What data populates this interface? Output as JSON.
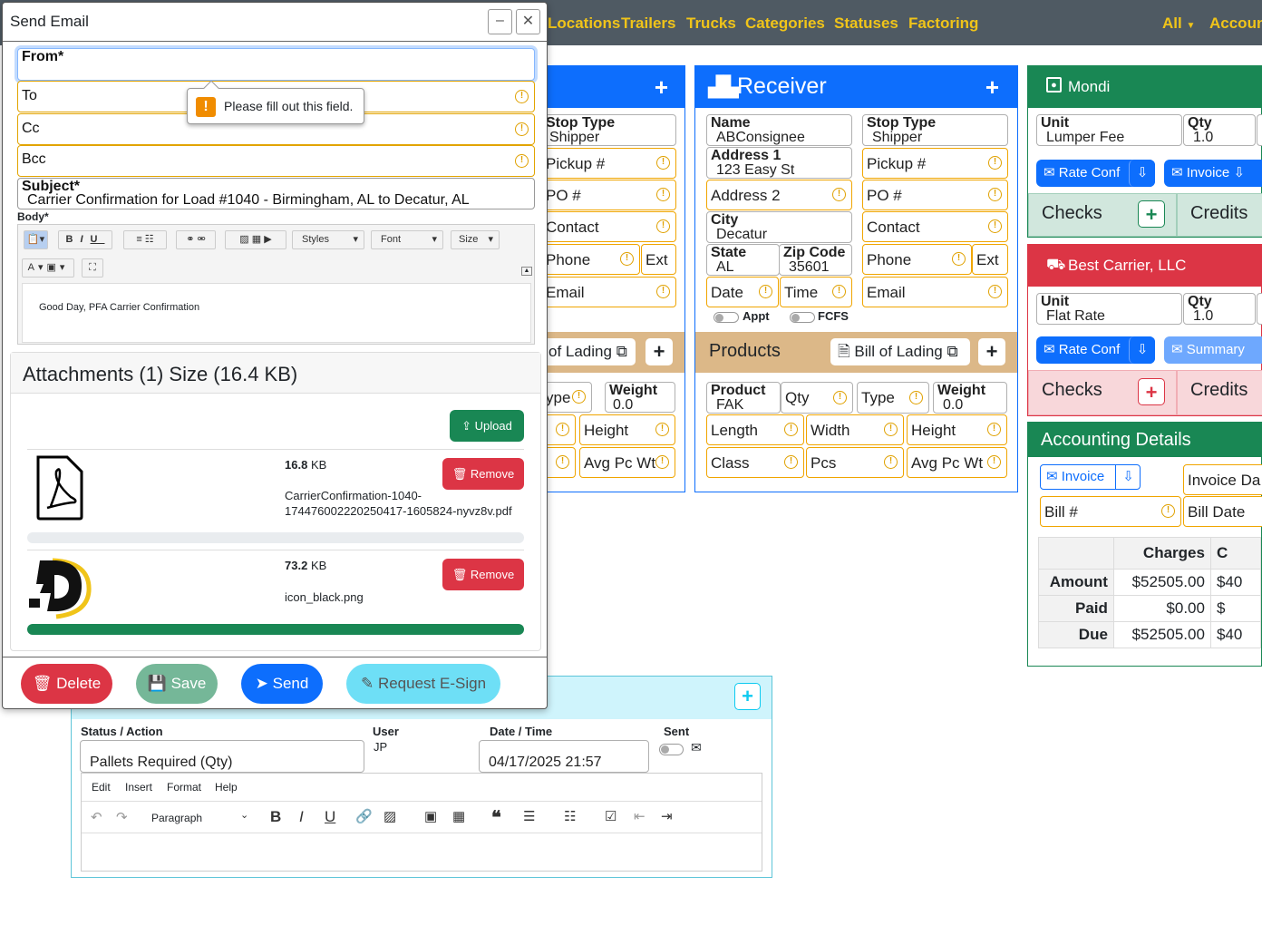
{
  "nav": {
    "items": [
      "Locations",
      "Trailers",
      "Trucks",
      "Categories",
      "Statuses",
      "Factoring"
    ],
    "all": "All",
    "account": "Account"
  },
  "shipper": {
    "plus": "+",
    "stop_type_label": "Stop Type",
    "stop_type_value": "Shipper",
    "pickup": "Pickup #",
    "po": "PO #",
    "contact": "Contact",
    "phone": "Phone",
    "ext": "Ext",
    "email": "Email",
    "bol": "of Lading",
    "type": "ype",
    "weight_label": "Weight",
    "weight_value": "0.0",
    "height": "Height",
    "avg": "Avg Pc Wt"
  },
  "receiver": {
    "title": "Receiver",
    "plus": "+",
    "name_label": "Name",
    "name_value": "ABConsignee",
    "address1_label": "Address 1",
    "address1_value": "123 Easy St",
    "address2": "Address 2",
    "city_label": "City",
    "city_value": "Decatur",
    "state_label": "State",
    "state_value": "AL",
    "zip_label": "Zip Code",
    "zip_value": "35601",
    "date": "Date",
    "time": "Time",
    "appt": "Appt",
    "fcfs": "FCFS",
    "stop_type_label": "Stop Type",
    "stop_type_value": "Shipper",
    "pickup": "Pickup #",
    "po": "PO #",
    "contact": "Contact",
    "phone": "Phone",
    "ext": "Ext",
    "email": "Email"
  },
  "products": {
    "title": "Products",
    "bol": "Bill of Lading",
    "plus": "+",
    "product_label": "Product",
    "product_value": "FAK",
    "qty": "Qty",
    "type": "Type",
    "weight_label": "Weight",
    "weight_value": "0.0",
    "length": "Length",
    "width": "Width",
    "height": "Height",
    "class": "Class",
    "pcs": "Pcs",
    "avg": "Avg Pc Wt"
  },
  "mondi": {
    "title": "Mondi",
    "unit_label": "Unit",
    "unit_value": "Lumper Fee",
    "qty_label": "Qty",
    "qty_value": "1.0",
    "rate_conf": "Rate Conf",
    "invoice": "Invoice",
    "checks": "Checks",
    "credits": "Credits",
    "plus": "+"
  },
  "carrier": {
    "title": "Best Carrier, LLC",
    "unit_label": "Unit",
    "unit_value": "Flat Rate",
    "qty_label": "Qty",
    "qty_value": "1.0",
    "rate_conf": "Rate Conf",
    "summary": "Summary",
    "checks": "Checks",
    "credits": "Credits",
    "plus": "+"
  },
  "accounting": {
    "title": "Accounting Details",
    "invoice": "Invoice",
    "invoice_date": "Invoice Da",
    "bill_no": "Bill #",
    "bill_date": "Bill Date",
    "col_charges": "Charges",
    "col_next": "C",
    "rows": [
      {
        "label": "Amount",
        "charges": "$52505.00",
        "next": "$40"
      },
      {
        "label": "Paid",
        "charges": "$0.00",
        "next": "$"
      },
      {
        "label": "Due",
        "charges": "$52505.00",
        "next": "$40"
      }
    ]
  },
  "status": {
    "plus": "+",
    "status_label": "Status / Action",
    "user_label": "User",
    "user_value": "JP",
    "datetime_label": "Date / Time",
    "datetime_value": "04/17/2025 21:57",
    "sent_label": "Sent",
    "status_value": "Pallets Required (Qty)",
    "menu": [
      "Edit",
      "Insert",
      "Format",
      "Help"
    ],
    "paragraph": "Paragraph"
  },
  "modal": {
    "title": "Send Email",
    "from": "From*",
    "to": "To",
    "cc": "Cc",
    "bcc": "Bcc",
    "subject_label": "Subject*",
    "subject_value": "Carrier Confirmation for Load #1040 - Birmingham, AL to Decatur, AL",
    "body_label": "Body*",
    "tooltip": "Please fill out this field.",
    "styles": "Styles",
    "font": "Font",
    "size": "Size",
    "body_text": "Good Day, PFA Carrier Confirmation",
    "attachments_title": "Attachments (1) Size (16.4 KB)",
    "upload": "Upload",
    "files": [
      {
        "size_num": "16.8",
        "size_unit": "KB",
        "name1": "CarrierConfirmation-1040-",
        "name2": "174476002220250417-1605824-nyvz8v.pdf",
        "remove": "Remove",
        "progress": 0
      },
      {
        "size_num": "73.2",
        "size_unit": "KB",
        "name1": "icon_black.png",
        "name2": "",
        "remove": "Remove",
        "progress": 1
      }
    ],
    "delete": "Delete",
    "save": "Save",
    "send": "Send",
    "esign": "Request E-Sign"
  },
  "colors": {
    "primary": "#0d6efd",
    "success": "#198754",
    "danger": "#dc3545",
    "tan": "#dcb888",
    "warning": "#e2a400",
    "nav_text": "#f0c419"
  }
}
